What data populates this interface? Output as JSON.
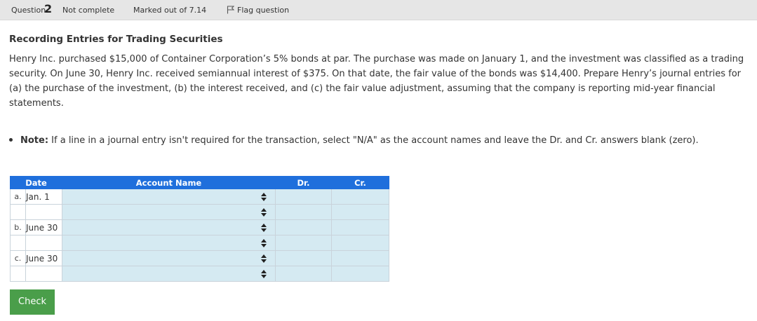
{
  "question_bar": {
    "label": "Question",
    "number": "2",
    "status": "Not complete",
    "marked": "Marked out of 7.14",
    "flag_label": "Flag question"
  },
  "content": {
    "title": "Recording Entries for Trading Securities",
    "paragraph": "Henry Inc. purchased $15,000 of Container Corporation’s 5% bonds at par. The purchase was made on January 1, and the investment was classified as a trading security. On June 30, Henry Inc. received semiannual interest of $375. On that date, the fair value of the bonds was $14,400. Prepare Henry’s journal entries for (a) the purchase of the investment, (b) the interest received, and (c) the fair value adjustment, assuming that the company is reporting mid-year financial statements.",
    "note_label": "Note:",
    "note_text": " If a line in a journal entry isn't required for the transaction, select \"N/A\" as the account names and leave the Dr. and Cr. answers blank (zero)."
  },
  "table": {
    "headers": {
      "date": "Date",
      "account": "Account Name",
      "dr": "Dr.",
      "cr": "Cr."
    },
    "rows": [
      {
        "letter": "a.",
        "date": "Jan. 1"
      },
      {
        "letter": "",
        "date": ""
      },
      {
        "letter": "b.",
        "date": "June 30"
      },
      {
        "letter": "",
        "date": ""
      },
      {
        "letter": "c.",
        "date": "June 30"
      },
      {
        "letter": "",
        "date": ""
      }
    ]
  },
  "check_label": "Check",
  "colors": {
    "header_blue": "#1f6fdc",
    "input_bg": "#d5eaf2",
    "check_green": "#4a9e4a",
    "bar_grey": "#e6e6e6"
  },
  "icons": {
    "flag": "flag-icon",
    "select": "updown-arrows-icon"
  }
}
